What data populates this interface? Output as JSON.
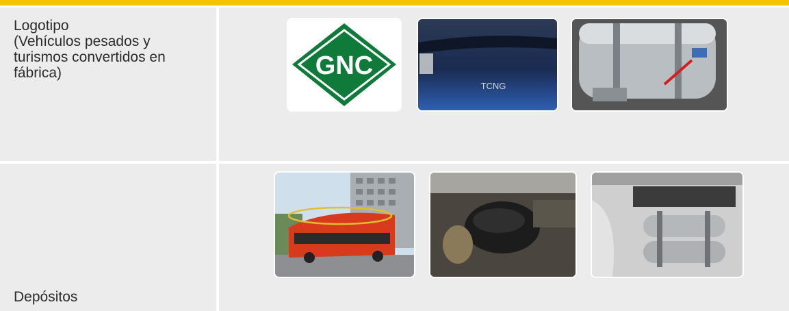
{
  "rows": [
    {
      "label_lines": [
        "Logotipo",
        "(Vehículos pesados y",
        "turismos convertidos en",
        "fábrica)"
      ],
      "images": [
        {
          "name": "gnc-logo",
          "text": "GNC"
        },
        {
          "name": "tcng-badge",
          "text": "TCNG"
        },
        {
          "name": "gnc-tank-close-up"
        }
      ]
    },
    {
      "label": "Depósitos",
      "images": [
        {
          "name": "bus-roof-tanks"
        },
        {
          "name": "underbody-tank"
        },
        {
          "name": "truck-side-tanks"
        }
      ]
    }
  ],
  "colors": {
    "accent": "#f5c400",
    "row_background": "#ececec",
    "logo_green": "#0f7a3a"
  }
}
